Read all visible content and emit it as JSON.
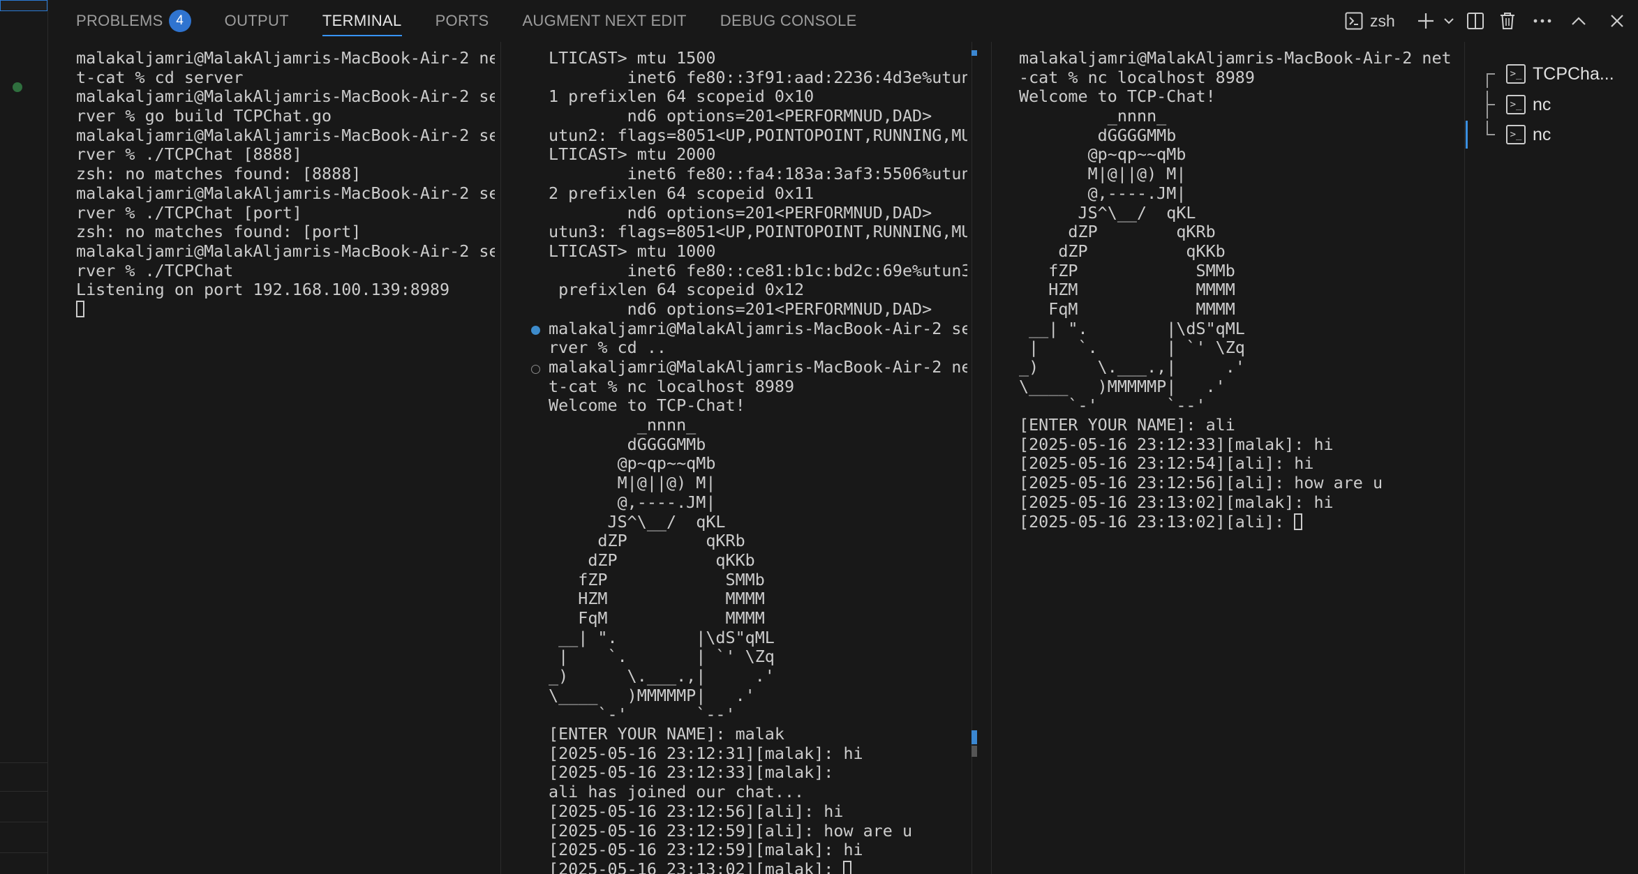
{
  "tabs": [
    {
      "label": "PROBLEMS",
      "badge": "4"
    },
    {
      "label": "OUTPUT"
    },
    {
      "label": "TERMINAL",
      "active": true
    },
    {
      "label": "PORTS"
    },
    {
      "label": "AUGMENT NEXT EDIT"
    },
    {
      "label": "DEBUG CONSOLE"
    }
  ],
  "toolbar": {
    "shell_label": "zsh",
    "icons": [
      "terminal-icon",
      "plus-icon",
      "chevron-down-icon",
      "split-icon",
      "trash-icon",
      "more-icon",
      "chevron-up-icon",
      "close-icon"
    ]
  },
  "terminal1": [
    "malakaljamri@MalakAljamris-MacBook-Air-2 ne",
    "t-cat % cd server",
    "malakaljamri@MalakAljamris-MacBook-Air-2 se",
    "rver % go build TCPChat.go",
    "malakaljamri@MalakAljamris-MacBook-Air-2 se",
    "rver % ./TCPChat [8888]",
    "zsh: no matches found: [8888]",
    "malakaljamri@MalakAljamris-MacBook-Air-2 se",
    "rver % ./TCPChat [port]",
    "zsh: no matches found: [port]",
    "malakaljamri@MalakAljamris-MacBook-Air-2 se",
    "rver % ./TCPChat",
    "Listening on port 192.168.100.139:8989"
  ],
  "terminal2": [
    "LTICAST> mtu 1500",
    "        inet6 fe80::3f91:aad:2236:4d3e%utun",
    "1 prefixlen 64 scopeid 0x10",
    "        nd6 options=201<PERFORMNUD,DAD>",
    "utun2: flags=8051<UP,POINTOPOINT,RUNNING,MU",
    "LTICAST> mtu 2000",
    "        inet6 fe80::fa4:183a:3af3:5506%utun",
    "2 prefixlen 64 scopeid 0x11",
    "        nd6 options=201<PERFORMNUD,DAD>",
    "utun3: flags=8051<UP,POINTOPOINT,RUNNING,MU",
    "LTICAST> mtu 1000",
    "        inet6 fe80::ce81:b1c:bd2c:69e%utun3",
    " prefixlen 64 scopeid 0x12",
    "        nd6 options=201<PERFORMNUD,DAD>",
    "malakaljamri@MalakAljamris-MacBook-Air-2 se",
    "rver % cd ..",
    "malakaljamri@MalakAljamris-MacBook-Air-2 ne",
    "t-cat % nc localhost 8989",
    "Welcome to TCP-Chat!",
    "         _nnnn_",
    "        dGGGGMMb",
    "       @p~qp~~qMb",
    "       M|@||@) M|",
    "       @,----.JM|",
    "      JS^\\__/  qKL",
    "     dZP        qKRb",
    "    dZP          qKKb",
    "   fZP            SMMb",
    "   HZM            MMMM",
    "   FqM            MMMM",
    " __| \".        |\\dS\"qML",
    " |    `.       | `' \\Zq",
    "_)      \\.___.,|     .'",
    "\\____   )MMMMMP|   .'",
    "     `-'       `--'",
    "[ENTER YOUR NAME]: malak",
    "[2025-05-16 23:12:31][malak]: hi",
    "[2025-05-16 23:12:33][malak]:",
    "ali has joined our chat...",
    "[2025-05-16 23:12:56][ali]: hi",
    "[2025-05-16 23:12:59][ali]: how are u",
    "[2025-05-16 23:12:59][malak]: hi",
    "[2025-05-16 23:13:02][malak]: "
  ],
  "terminal3": [
    "malakaljamri@MalakAljamris-MacBook-Air-2 net",
    "-cat % nc localhost 8989",
    "Welcome to TCP-Chat!",
    "         _nnnn_",
    "        dGGGGMMb",
    "       @p~qp~~qMb",
    "       M|@||@) M|",
    "       @,----.JM|",
    "      JS^\\__/  qKL",
    "     dZP        qKRb",
    "    dZP          qKKb",
    "   fZP            SMMb",
    "   HZM            MMMM",
    "   FqM            MMMM",
    " __| \".        |\\dS\"qML",
    " |    `.       | `' \\Zq",
    "_)      \\.___.,|     .'",
    "\\____   )MMMMMP|   .'",
    "     `-'       `--'",
    "[ENTER YOUR NAME]: ali",
    "[2025-05-16 23:12:33][malak]: hi",
    "[2025-05-16 23:12:54][ali]: hi",
    "[2025-05-16 23:12:56][ali]: how are u",
    "[2025-05-16 23:13:02][malak]: hi",
    "[2025-05-16 23:13:02][ali]: "
  ],
  "terminal_list": [
    {
      "label": "TCPCha..."
    },
    {
      "label": "nc"
    },
    {
      "label": "nc",
      "selected": true
    }
  ]
}
